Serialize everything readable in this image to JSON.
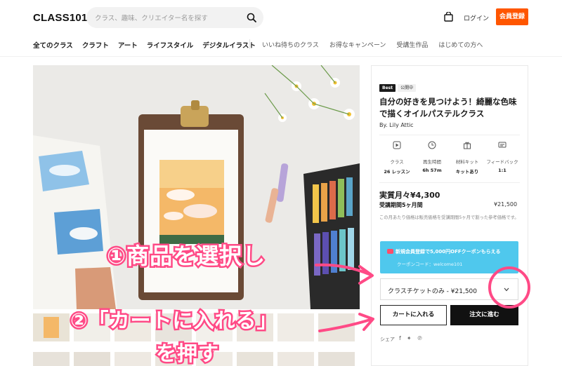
{
  "header": {
    "logo": "CLASS101",
    "search_placeholder": "クラス、趣味、クリエイター名を探す",
    "login": "ログイン",
    "signup": "会員登録"
  },
  "nav": {
    "main": [
      "全てのクラス",
      "クラフト",
      "アート",
      "ライフスタイル",
      "デジタルイラスト"
    ],
    "sub": [
      "いいね待ちのクラス",
      "お得なキャンペーン",
      "受講生作品",
      "はじめての方へ"
    ]
  },
  "product": {
    "badges": [
      "Best",
      "公開中"
    ],
    "title": "自分の好きを見つけよう！綺麗な色味で描くオイルパステルクラス",
    "author": "By. Lily Attic",
    "infos": [
      {
        "icon": "play-icon",
        "label": "クラス",
        "value": "26 レッスン"
      },
      {
        "icon": "clock-icon",
        "label": "再生時間",
        "value": "6h 57m"
      },
      {
        "icon": "kit-icon",
        "label": "材料キット",
        "value": "キットあり"
      },
      {
        "icon": "feedback-icon",
        "label": "フィードバック",
        "value": "1:1"
      }
    ],
    "monthly_price": "実質月々¥4,300",
    "period": "受講期間5ヶ月間",
    "total": "¥21,500",
    "note": "この月あたり価格は販売価格を受講期間5ヶ月で割った参考価格です。",
    "coupon": {
      "title": "新規会員登録で5,000円OFFクーポンもらえる",
      "code": "クーポンコード：welcome101",
      "color": "#4fc8ed"
    },
    "select_value": "クラスチケットのみ - ¥21,500",
    "cart_button": "カートに入れる",
    "order_button": "注文に進む",
    "share_label": "シェア",
    "share_icons": [
      "facebook-icon",
      "twitter-icon",
      "pinterest-icon"
    ]
  },
  "annotations": {
    "step1": "①商品を選択し",
    "step2": "②「カートに入れる」",
    "step3": "を押す",
    "color": "#ff4a86"
  },
  "colors": {
    "brand": "#ff5600",
    "dark": "#111111"
  }
}
